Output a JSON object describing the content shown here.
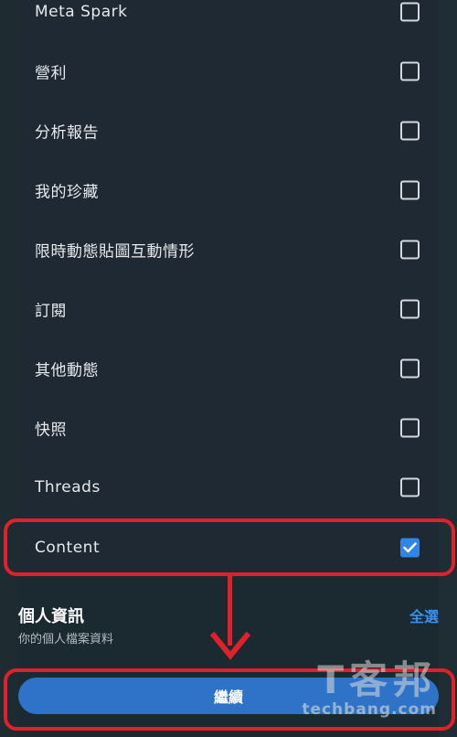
{
  "permissions": {
    "items": [
      {
        "label": "Meta Spark",
        "checked": false
      },
      {
        "label": "營利",
        "checked": false
      },
      {
        "label": "分析報告",
        "checked": false
      },
      {
        "label": "我的珍藏",
        "checked": false
      },
      {
        "label": "限時動態貼圖互動情形",
        "checked": false
      },
      {
        "label": "訂閱",
        "checked": false
      },
      {
        "label": "其他動態",
        "checked": false
      },
      {
        "label": "快照",
        "checked": false
      },
      {
        "label": "Threads",
        "checked": false
      },
      {
        "label": "Content",
        "checked": true
      }
    ]
  },
  "personal_info": {
    "title": "個人資訊",
    "subtitle": "你的個人檔案資料",
    "select_all_label": "全選"
  },
  "footer": {
    "continue_label": "繼續"
  },
  "watermark": {
    "logo_text": "T客邦",
    "site": "techbang.com"
  },
  "colors": {
    "accent": "#2f86e6",
    "highlight": "#e0202a"
  }
}
